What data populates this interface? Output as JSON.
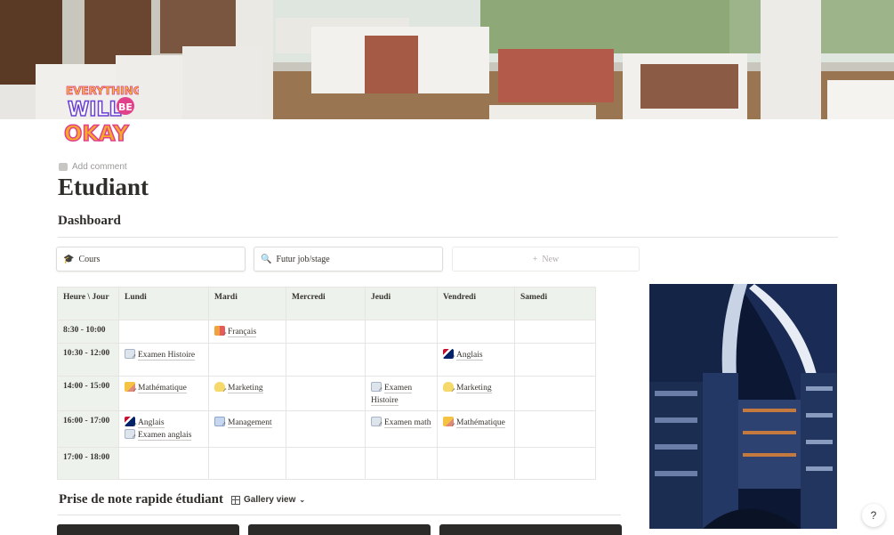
{
  "page": {
    "title": "Etudiant",
    "add_comment": "Add comment",
    "icon_text": [
      "EVERYTHING",
      "WILL",
      "BE",
      "OKAY"
    ]
  },
  "dashboard": {
    "heading": "Dashboard",
    "buttons": [
      {
        "label": "Cours",
        "icon": "graduation-cap-icon"
      },
      {
        "label": "Futur job/stage",
        "icon": "magnifier-icon"
      }
    ],
    "new_label": "New"
  },
  "schedule": {
    "headers": [
      "Heure \\ Jour",
      "Lundi",
      "Mardi",
      "Mercredi",
      "Jeudi",
      "Vendredi",
      "Samedi"
    ],
    "rows": [
      {
        "hour": "8:30 - 10:00",
        "cells": [
          [],
          [
            {
              "icon": "fr",
              "text": "Français"
            }
          ],
          [],
          [],
          [],
          []
        ]
      },
      {
        "hour": "10:30 - 12:00",
        "cells": [
          [
            {
              "icon": "doc",
              "text": "Examen Histoire"
            }
          ],
          [],
          [],
          [],
          [
            {
              "icon": "flag",
              "text": "Anglais"
            }
          ],
          []
        ]
      },
      {
        "hour": "14:00 - 15:00",
        "cells": [
          [
            {
              "icon": "pencil",
              "text": "Mathématique"
            }
          ],
          [
            {
              "icon": "bulb",
              "text": "Marketing"
            }
          ],
          [],
          [
            {
              "icon": "doc",
              "text": "Examen Histoire"
            }
          ],
          [
            {
              "icon": "bulb",
              "text": "Marketing"
            }
          ],
          []
        ]
      },
      {
        "hour": "16:00 - 17:00",
        "cells": [
          [
            {
              "icon": "flag",
              "text": "Anglais"
            },
            {
              "icon": "doc",
              "text": "Examen anglais"
            }
          ],
          [
            {
              "icon": "mgmt",
              "text": "Management"
            }
          ],
          [],
          [
            {
              "icon": "doc",
              "text": "Examen math"
            }
          ],
          [
            {
              "icon": "pencil",
              "text": "Mathématique"
            }
          ],
          []
        ]
      },
      {
        "hour": "17:00 - 18:00",
        "cells": [
          [],
          [],
          [],
          [],
          [],
          []
        ]
      }
    ]
  },
  "gallery": {
    "title": "Prise de note rapide étudiant",
    "view_label": "Gallery view",
    "card_count": 3
  },
  "help": {
    "label": "?"
  }
}
